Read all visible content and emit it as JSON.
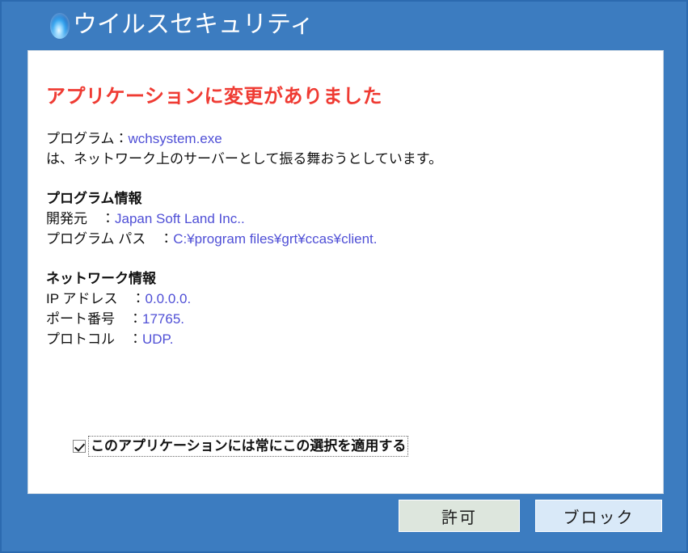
{
  "window": {
    "title": "ウイルスセキュリティ",
    "title_icon": "blue-orb-icon",
    "frame_color": "#3c7cc0",
    "panel_color": "#ffffff"
  },
  "alert": {
    "heading": "アプリケーションに変更がありました",
    "heading_color": "#ef3b33",
    "value_color": "#4f4fd6",
    "program_label": "プログラム：",
    "program_name": "wchsystem.exe",
    "description": "は、ネットワーク上のサーバーとして振る舞おうとしています。"
  },
  "program_info": {
    "section_title": "プログラム情報",
    "rows": [
      {
        "label": "開発元　：",
        "value": "Japan Soft Land Inc.."
      },
      {
        "label": "プログラム パス　：",
        "value": "C:¥program files¥grt¥ccas¥client."
      }
    ]
  },
  "network_info": {
    "section_title": "ネットワーク情報",
    "rows": [
      {
        "label": "IP アドレス　：",
        "value": "0.0.0.0."
      },
      {
        "label": "ポート番号　：",
        "value": "17765."
      },
      {
        "label": "プロトコル　：",
        "value": "UDP."
      }
    ]
  },
  "options": {
    "always_apply": {
      "label": "このアプリケーションには常にこの選択を適用する",
      "checked": true
    }
  },
  "buttons": {
    "allow": "許可",
    "block": "ブロック"
  }
}
